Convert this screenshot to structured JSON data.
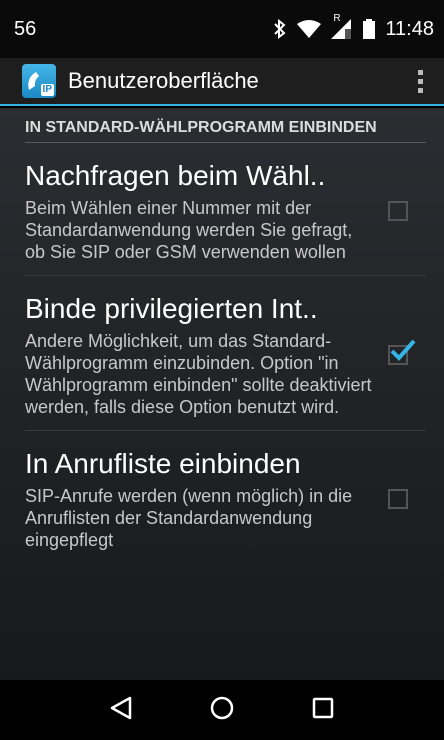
{
  "status": {
    "notification_count": "56",
    "time": "11:48",
    "signal_label": "R"
  },
  "app": {
    "title": "Benutzeroberfläche",
    "icon_label": "IP"
  },
  "section": {
    "header": "IN STANDARD-WÄHLPROGRAMM EINBINDEN"
  },
  "prefs": [
    {
      "title": "Nachfragen beim Wähl..",
      "summary": "Beim Wählen einer Nummer mit der Standardanwendung werden Sie gefragt, ob Sie SIP oder GSM verwenden wollen",
      "checked": false
    },
    {
      "title": "Binde privilegierten Int..",
      "summary": "Andere Möglichkeit, um das Standard-Wählprogramm einzubinden. Option \"in Wählprogramm einbinden\" sollte deaktiviert werden, falls diese Option benutzt wird.",
      "checked": true
    },
    {
      "title": "In Anrufliste einbinden",
      "summary": "SIP-Anrufe werden (wenn möglich) in die Anruflisten der Standardanwendung eingepflegt",
      "checked": false
    }
  ],
  "colors": {
    "accent": "#33b5e5"
  }
}
